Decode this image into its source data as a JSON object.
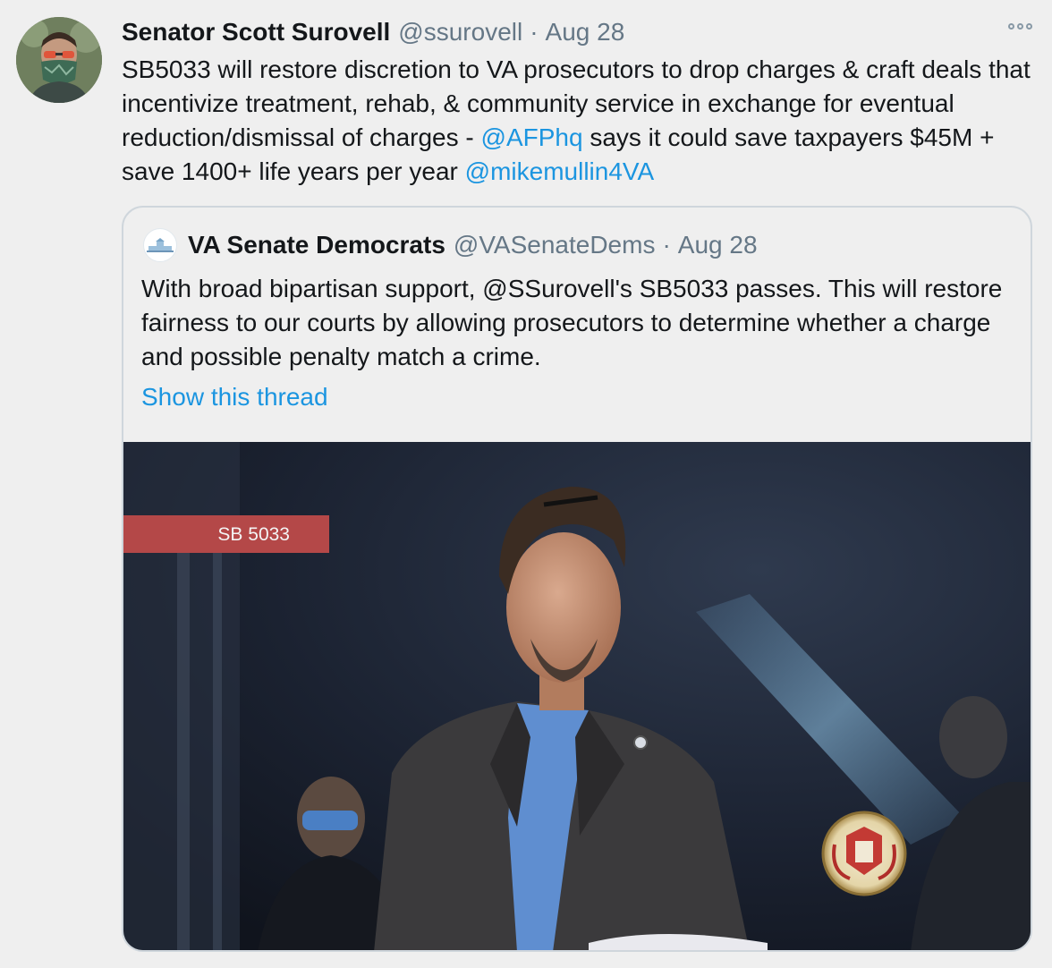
{
  "tweet": {
    "author_name": "Senator Scott Surovell",
    "author_handle": "@ssurovell",
    "separator": "·",
    "date": "Aug 28",
    "text_part1": "SB5033 will restore discretion to VA prosecutors to drop charges & craft deals that incentivize treatment, rehab, & community service in exchange for eventual reduction/dismissal of charges - ",
    "mention1": "@AFPhq",
    "text_part2": " says it could save taxpayers $45M + save 1400+ life years per year ",
    "mention2": "@mikemullin4VA"
  },
  "quoted_tweet": {
    "author_name": "VA Senate Democrats",
    "author_handle": "@VASenateDems",
    "separator": "·",
    "date": "Aug 28",
    "text": "With broad bipartisan support, @SSurovell's SB5033 passes. This will restore fairness to our courts by allowing prosecutors to determine whether a charge and possible penalty match a crime.",
    "show_thread": "Show this thread",
    "media": {
      "bill_label": "SB 5033"
    }
  },
  "colors": {
    "link": "#1b95e0",
    "secondary_text": "#657786",
    "background": "#efefef",
    "border": "#cfd6dc",
    "bill_banner": "#b44848"
  },
  "icons": {
    "more": "more-options-icon"
  }
}
